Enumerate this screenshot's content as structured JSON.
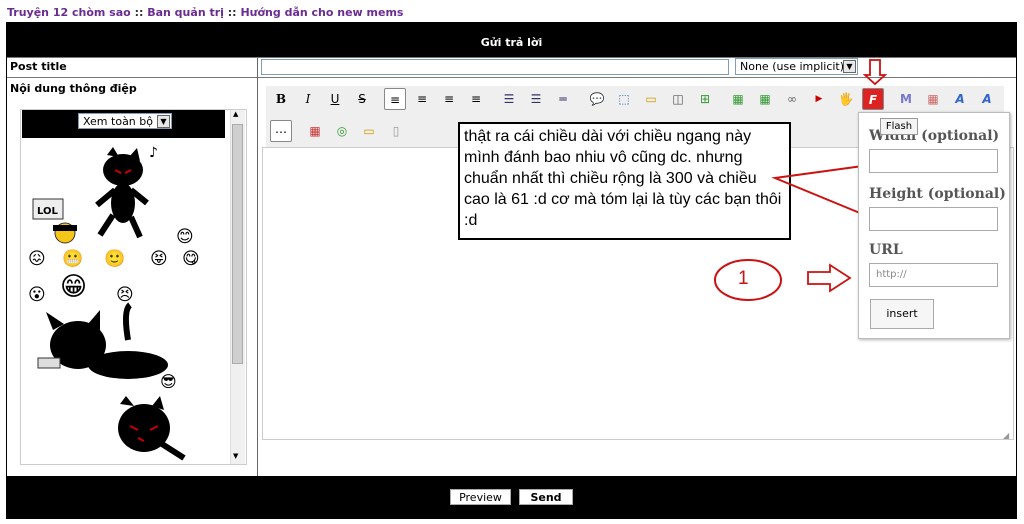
{
  "breadcrumb": {
    "item1": "Truyện 12 chòm sao",
    "sep1": "::",
    "item2": "Ban quản trị",
    "sep2": "::",
    "item3": "Hướng dẫn cho new mems"
  },
  "header": {
    "title": "Gửi trả lời"
  },
  "form": {
    "post_title_label": "Post title",
    "post_title_value": "",
    "icon_select": "None (use implicit)",
    "content_label": "Nội dung thông điệp"
  },
  "smilies": {
    "view_select": "Xem toàn bộ"
  },
  "toolbar": {
    "row1": [
      "B",
      "I",
      "U",
      "S",
      "≡",
      "≡",
      "≡",
      "≡",
      "☰",
      "☰",
      "═",
      "💬",
      "⬚",
      "▭",
      "◫",
      "⊞",
      "▦",
      "▦",
      "∞",
      "▶",
      "🖐",
      "F",
      "M",
      "▦",
      "A",
      "A"
    ],
    "row2": [
      "⋯",
      "▦",
      "◎",
      "▭",
      "▯"
    ]
  },
  "note": {
    "text": "thật ra cái chiều dài với chiều ngang này mình đánh bao nhiu vô cũng dc. nhưng chuẩn nhất thì chiều rộng là 300 và chiều cao là 61 :d cơ mà tóm lại là tùy các bạn thôi :d"
  },
  "annotation": {
    "number": "1"
  },
  "flash_popup": {
    "tooltip": "Flash",
    "width_label": "Width (optional)",
    "height_label": "Height (optional)",
    "url_label": "URL",
    "url_placeholder": "http://",
    "insert_label": "insert"
  },
  "footer": {
    "preview_label": "Preview",
    "send_label": "Send"
  },
  "colors": {
    "breadcrumb": "#6b2c91",
    "annotation": "#cc1111",
    "bar": "#000000"
  }
}
